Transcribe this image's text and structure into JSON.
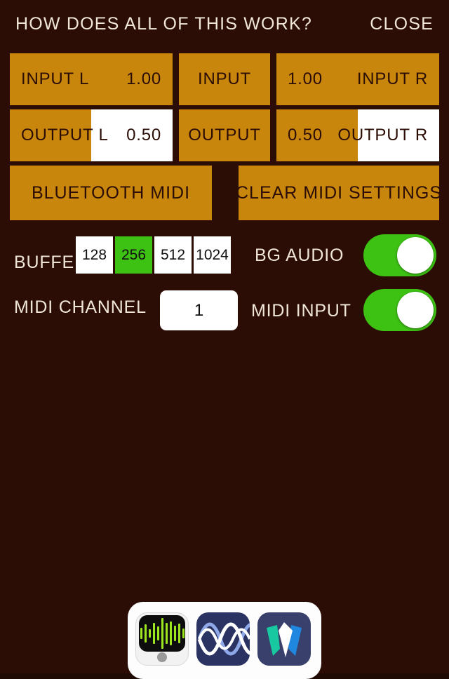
{
  "header": {
    "title": "HOW DOES ALL OF THIS WORK?",
    "close_label": "CLOSE"
  },
  "colors": {
    "background": "#2b0d05",
    "gold": "#c8860d",
    "text_light": "#efe6d8",
    "green": "#3dc214",
    "white": "#ffffff"
  },
  "params": {
    "input": {
      "left": {
        "label": "INPUT L",
        "value": "1.00",
        "fill_percent": 0
      },
      "center": {
        "label": "INPUT"
      },
      "right": {
        "label": "INPUT R",
        "value": "1.00",
        "fill_percent": 0
      }
    },
    "output": {
      "left": {
        "label": "OUTPUT L",
        "value": "0.50",
        "fill_percent": 50
      },
      "center": {
        "label": "OUTPUT"
      },
      "right": {
        "label": "OUTPUT R",
        "value": "0.50",
        "fill_percent": 50
      }
    }
  },
  "buttons": {
    "bluetooth_midi": "BLUETOOTH MIDI",
    "clear_midi_settings": "CLEAR MIDI SETTINGS"
  },
  "buffer": {
    "label": "BUFFER",
    "options": [
      "128",
      "256",
      "512",
      "1024"
    ],
    "selected": "256"
  },
  "bg_audio": {
    "label": "BG AUDIO",
    "state": "on"
  },
  "midi_channel": {
    "label": "MIDI CHANNEL",
    "value": "1"
  },
  "midi_input": {
    "label": "MIDI INPUT",
    "state": "on"
  },
  "dock": {
    "icons": [
      {
        "name": "audiobus-recorder-icon"
      },
      {
        "name": "sine-wave-synth-icon"
      },
      {
        "name": "chevron-app-icon"
      }
    ]
  }
}
